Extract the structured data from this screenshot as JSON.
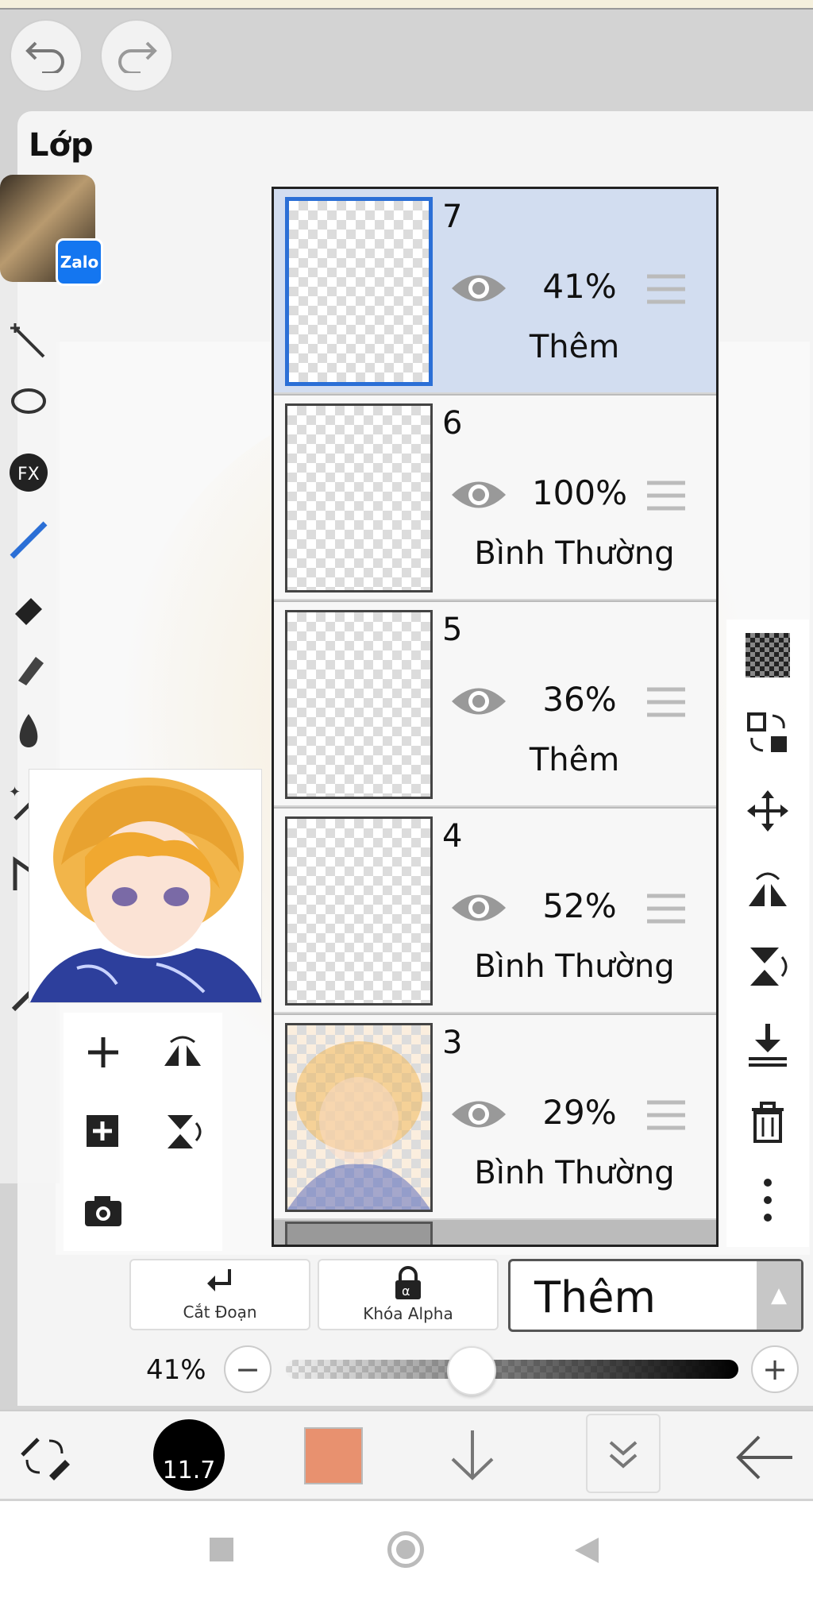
{
  "panel": {
    "title": "Lớp"
  },
  "zalo": {
    "badge": "Zalo"
  },
  "layers": [
    {
      "number": "7",
      "opacity": "41%",
      "blend": "Thêm",
      "selected": true
    },
    {
      "number": "6",
      "opacity": "100%",
      "blend": "Bình Thường",
      "selected": false
    },
    {
      "number": "5",
      "opacity": "36%",
      "blend": "Thêm",
      "selected": false
    },
    {
      "number": "4",
      "opacity": "52%",
      "blend": "Bình Thường",
      "selected": false
    },
    {
      "number": "3",
      "opacity": "29%",
      "blend": "Bình Thường",
      "selected": false
    }
  ],
  "bottom_panel": {
    "clipping_label": "Cắt Đoạn",
    "alpha_lock_label": "Khóa Alpha",
    "blend_mode": "Thêm",
    "opacity_label": "41%",
    "opacity_value": 0.41
  },
  "toolbar": {
    "brush_size": "11.7",
    "color": "#e8916f"
  },
  "icons": [
    "undo-icon",
    "redo-icon",
    "eye-icon",
    "drag-handle-icon",
    "checker-icon",
    "transfer-icon",
    "move-icon",
    "flip-h-icon",
    "flip-v-icon",
    "merge-down-icon",
    "trash-icon",
    "more-icon",
    "add-layer-icon",
    "camera-icon",
    "arrow-down-icon",
    "back-arrow-icon",
    "expand-icon",
    "swap-tools-icon"
  ]
}
